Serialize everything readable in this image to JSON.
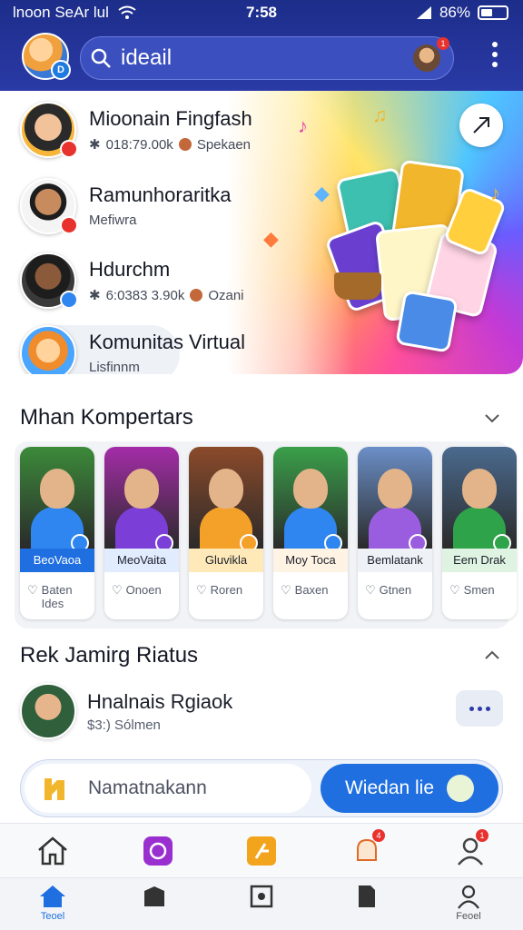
{
  "status_bar": {
    "carrier": "lnoon SeAr lul",
    "time": "7:58",
    "battery": "86%"
  },
  "search": {
    "placeholder": "ideail",
    "value": "ideail"
  },
  "hero": {
    "contacts": [
      {
        "name": "Mioonain Fingfash",
        "meta": "018:79.00k",
        "meta_tag": "Spekaen"
      },
      {
        "name": "Ramunhoraritka",
        "meta": "Mefiwra",
        "meta_tag": ""
      },
      {
        "name": "Hdurchm",
        "meta": "6:0383 3.90k",
        "meta_tag": "Ozani"
      }
    ],
    "community": {
      "name": "Komunitas Virtual",
      "sub": "Lisfinnm"
    }
  },
  "section_stories": {
    "title": "Mhan Kompertars",
    "items": [
      {
        "caption": "BeoVaoa",
        "action": "Baten",
        "action2": "Ides",
        "cap_bg": "#1f6fe0",
        "cap_fg": "#ffffff",
        "badge": "#2f86f0",
        "photo": "#3c8a3a"
      },
      {
        "caption": "MeoVaita",
        "action": "Onoen",
        "action2": "",
        "cap_bg": "#e2ecff",
        "cap_fg": "#1b1f2a",
        "badge": "#7b3fd8",
        "photo": "#a42ca8"
      },
      {
        "caption": "Gluvikla",
        "action": "Roren",
        "action2": "",
        "cap_bg": "#ffe9b8",
        "cap_fg": "#1b1f2a",
        "badge": "#f4a12a",
        "photo": "#8b4a2a"
      },
      {
        "caption": "Moy Toca",
        "action": "Baxen",
        "action2": "",
        "cap_bg": "#fff3e4",
        "cap_fg": "#1b1f2a",
        "badge": "#2f86f0",
        "photo": "#3aa04a"
      },
      {
        "caption": "Bemlatank",
        "action": "Gtnen",
        "action2": "",
        "cap_bg": "#eef1f6",
        "cap_fg": "#1b1f2a",
        "badge": "#9a5de0",
        "photo": "#6b8fc8"
      },
      {
        "caption": "Eem Drak",
        "action": "Smen",
        "action2": "",
        "cap_bg": "#dff3e2",
        "cap_fg": "#1b1f2a",
        "badge": "#2fa34a",
        "photo": "#4a6a8e"
      }
    ]
  },
  "section_live": {
    "title": "Rek Jamirg Riatus",
    "name": "Hnalnais Rgiaok",
    "meta": "$3:) Sólmen"
  },
  "action_bar": {
    "input_label": "Namatnakann",
    "button_label": "Wiedan lie"
  },
  "nav": {
    "home_label": "Teoel",
    "profile_label": "Feoel"
  },
  "colors": {
    "header": "#1d2d8a",
    "accent": "#1f6fe0",
    "notification": "#e8322e"
  }
}
